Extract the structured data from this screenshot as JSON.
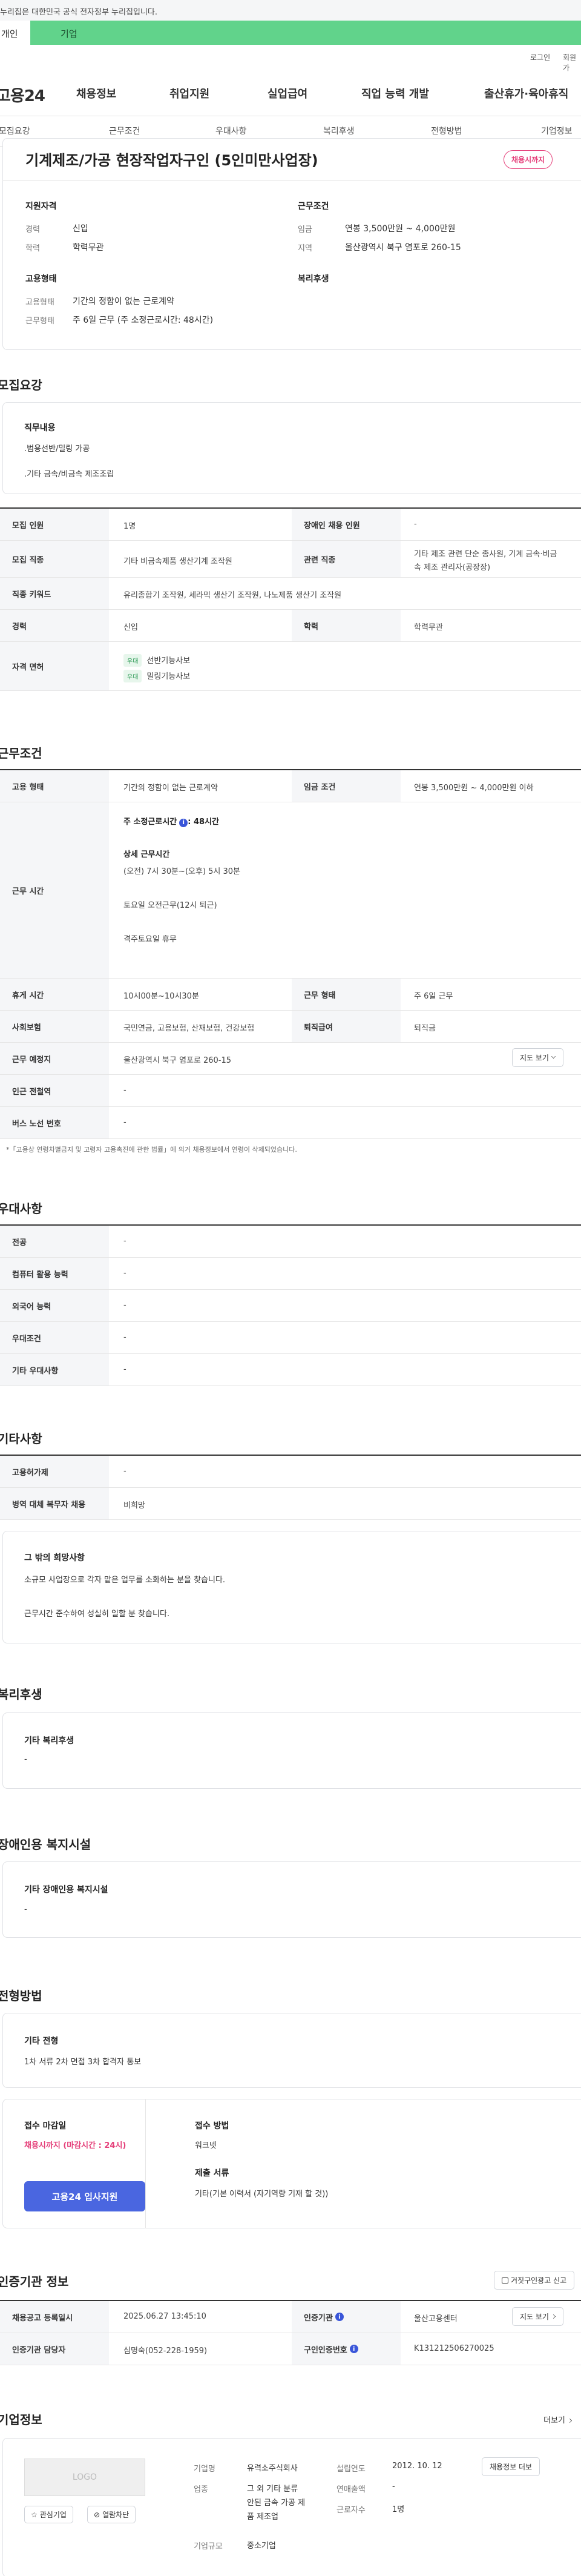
{
  "gov_banner": {
    "text": "이 누리집은 대한민국 공식 전자정부 누리집입니다."
  },
  "top_tabs": {
    "personal": "개인",
    "company": "기업"
  },
  "util": {
    "login": "로그인",
    "join": "회원가"
  },
  "header": {
    "logo": "고용24",
    "nav": [
      "채용정보",
      "취업지원",
      "실업급여",
      "직업 능력 개발",
      "출산휴가·육아휴직"
    ]
  },
  "subnav": [
    "모집요강",
    "근무조건",
    "우대사항",
    "복리후생",
    "전형방법",
    "기업정보"
  ],
  "summary": {
    "title": "기계제조/가공 현장작업자구인 (5인미만사업장)",
    "status_badge": "채용시까지",
    "applicant_title": "지원자격",
    "career_label": "경력",
    "career": "신입",
    "edu_label": "학력",
    "edu": "학력무관",
    "work_title": "근무조건",
    "wage_label": "임금",
    "wage": "연봉 3,500만원 ~ 4,000만원",
    "loc_label": "지역",
    "loc": "울산광역시 북구 염포로 260-15",
    "emp_title": "고용형태",
    "emp_label": "고용형태",
    "emp": "기간의 정함이 없는 근로계약",
    "hours_label": "근무형태",
    "hours": "주 6일 근무 (주 소정근로시간: 48시간)",
    "welfare_title": "복리후생"
  },
  "recruit": {
    "title": "모집요강",
    "duty_title": "직무내용",
    "duty_lines": [
      ".범용선반/밀링 가공",
      ".기타 금속/비금속 제조조립"
    ],
    "rows": {
      "count_label": "모집 인원",
      "count": "1명",
      "disabled_label": "장애인 채용 인원",
      "disabled": "-",
      "job_label": "모집 직종",
      "job": "기타 비금속제품 생산기계 조작원",
      "related_label": "관련 직종",
      "related": [
        "기타 제조 관련 단순 종사원, 기계 금속·비금",
        "속 제조 관리자(공장장)"
      ],
      "kw_label": "직종 키워드",
      "kw": "유리종합기 조작원, 세라믹 생산기 조작원, 나노제품 생산기 조작원",
      "career_label": "경력",
      "career": "신입",
      "edu_label": "학력",
      "edu": "학력무관",
      "license_label": "자격 면허",
      "license_tag": "우대",
      "licenses": [
        "선반기능사보",
        "밀링기능사보"
      ]
    }
  },
  "conditions": {
    "title": "근무조건",
    "emp_label": "고용 형태",
    "emp": "기간의 정함이 없는 근로계약",
    "wage_label": "임금 조건",
    "wage": "연봉 3,500만원 ~ 4,000만원 이하",
    "time_label": "근무 시간",
    "time_std": "주 소정근로시간",
    "time_std_val": ": 48시간",
    "time_detail_title": "상세 근무시간",
    "time_lines": [
      "(오전) 7시 30분~(오후) 5시 30분",
      "토요일 오전근무(12시 퇴근)",
      "격주토요일 휴무"
    ],
    "break_label": "휴게 시간",
    "break": "10시00분~10시30분",
    "form_label": "근무 형태",
    "form": "주 6일 근무",
    "ins_label": "사회보험",
    "ins": "국민연금, 고용보험, 산재보험, 건강보험",
    "ret_label": "퇴직급여",
    "ret": "퇴직금",
    "place_label": "근무 예정지",
    "place": "울산광역시 북구 염포로 260-15",
    "map_btn": "지도 보기",
    "subway_label": "인근 전철역",
    "subway": "-",
    "bus_label": "버스 노선 번호",
    "bus": "-",
    "note": "*「고용상 연령차별금지 및 고령자 고용촉진에 관한 법률」에 의거 채용정보에서 연령이 삭제되었습니다."
  },
  "prefer": {
    "title": "우대사항",
    "rows": [
      {
        "label": "전공",
        "val": "-"
      },
      {
        "label": "컴퓨터 활용 능력",
        "val": "-"
      },
      {
        "label": "외국어 능력",
        "val": "-"
      },
      {
        "label": "우대조건",
        "val": "-"
      },
      {
        "label": "기타 우대사항",
        "val": "-"
      }
    ]
  },
  "etc": {
    "title": "기타사항",
    "rows": [
      {
        "label": "고용허가제",
        "val": "-"
      },
      {
        "label": "병역 대체 복무자 채용",
        "val": "비희망"
      }
    ],
    "hope_title": "그 밖의 희망사항",
    "hope_lines": [
      "소규모 사업장으로 각자 맡은 업무를 소화하는 분을 찾습니다.",
      "근무시간 준수하여 성실히 일할 분 찾습니다."
    ]
  },
  "welfare": {
    "title": "복리후생",
    "sub": "기타 복리후생",
    "val": "-"
  },
  "disabled_fac": {
    "title": "장애인용 복지시설",
    "sub": "기타 장애인용 복지시설",
    "val": "-"
  },
  "selection": {
    "title": "전형방법",
    "sub": "기타 전형",
    "val": "1차 서류 2차 면접 3차 합격자 통보",
    "deadline_title": "접수 마감일",
    "deadline": "채용시까지 (마감시간 : 24시)",
    "method_title": "접수 방법",
    "method": "워크넷",
    "docs_title": "제출 서류",
    "docs": "기타(기본 이력서 (자기역량 기재 할 것))",
    "apply_btn": "고용24 입사지원"
  },
  "agency": {
    "title": "인증기관 정보",
    "report_btn": "거짓구인광고 신고",
    "reg_label": "채용공고 등록일시",
    "reg": "2025.06.27 13:45:10",
    "org_label": "인증기관",
    "org": "울산고용센터",
    "map_btn": "지도 보기",
    "person_label": "인증기관 담당자",
    "person": "심명숙(052-228-1959)",
    "num_label": "구인인증번호",
    "num": "K131212506270025"
  },
  "company": {
    "title": "기업정보",
    "more": "더보기",
    "logo": "LOGO",
    "fav_btn": "관심기업",
    "hide_btn": "열람차단",
    "name_label": "기업명",
    "name": "유력소주식회사",
    "year_label": "설립연도",
    "year": "2012. 10. 12",
    "ind_label": "업종",
    "ind": [
      "그 외 기타 분류",
      "안된 금속 가공 제",
      "품 제조업"
    ],
    "sales_label": "연매출액",
    "sales": "-",
    "emp_label": "근로자수",
    "emp": "1명",
    "size_label": "기업규모",
    "size": "중소기업",
    "reg_btn": "채용정보 더보"
  }
}
